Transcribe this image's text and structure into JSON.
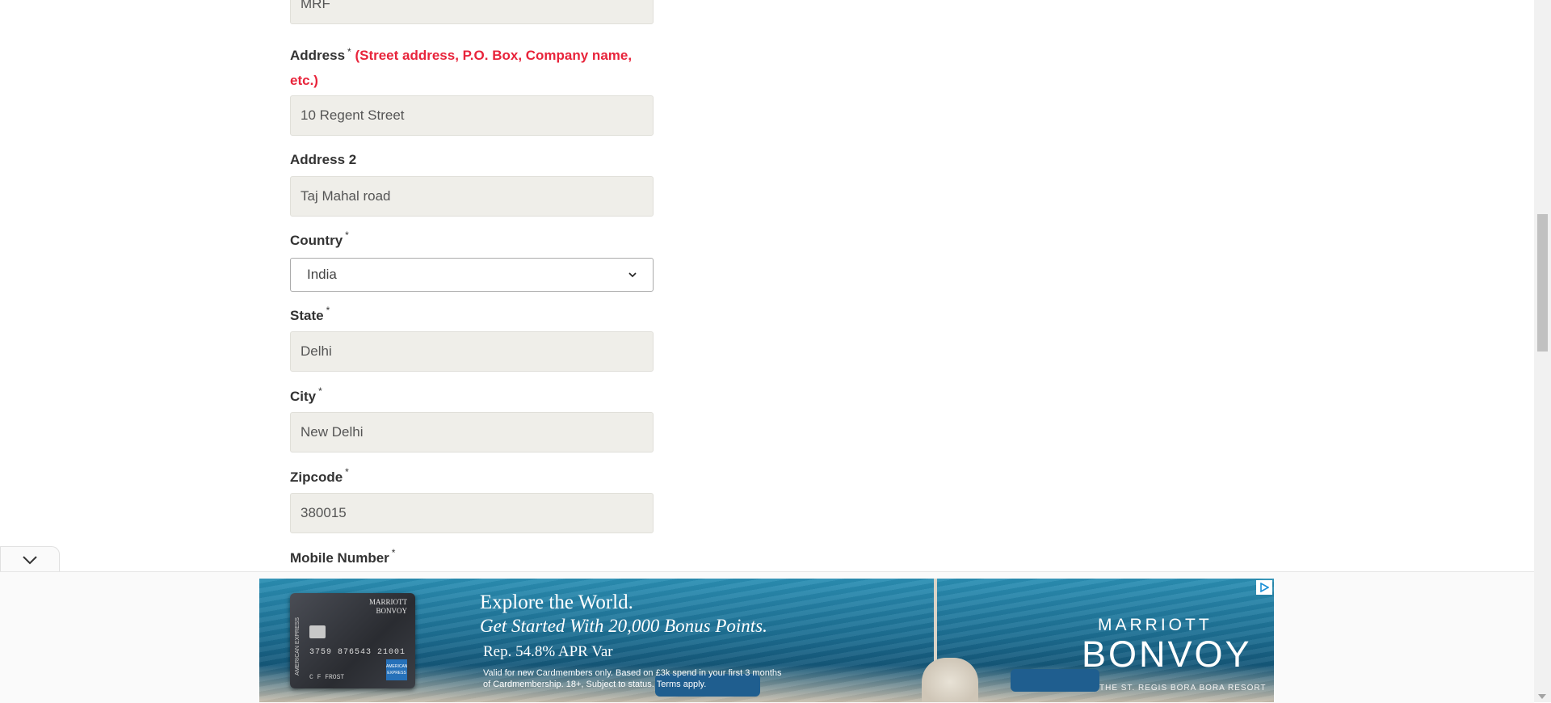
{
  "form": {
    "company_value": "MRF",
    "address": {
      "label": "Address",
      "required_mark": "*",
      "hint": "(Street address, P.O. Box, Company name, etc.)",
      "value": "10 Regent Street"
    },
    "address2": {
      "label": "Address 2",
      "value": "Taj Mahal road"
    },
    "country": {
      "label": "Country",
      "required_mark": "*",
      "selected": "India"
    },
    "state": {
      "label": "State",
      "required_mark": "*",
      "value": "Delhi"
    },
    "city": {
      "label": "City",
      "required_mark": "*",
      "value": "New Delhi"
    },
    "zipcode": {
      "label": "Zipcode",
      "required_mark": "*",
      "value": "380015"
    },
    "mobile": {
      "label": "Mobile Number",
      "required_mark": "*"
    }
  },
  "ad": {
    "line1": "Explore the World.",
    "line2": "Get Started With 20,000 Bonus Points.",
    "line3": "Rep. 54.8% APR Var",
    "small_line1": "Valid for new Cardmembers only. Based on £3k spend in your first 3 months",
    "small_line2": "of Cardmembership. 18+, Subject to status. Terms apply.",
    "brand_top": "MARRIOTT",
    "brand_main": "BONVOY",
    "brand_sub": "THE ST. REGIS BORA BORA RESORT",
    "card_brand_top": "MARRIOTT",
    "card_brand_main": "BONVOY",
    "card_number": "3759 876543 21001",
    "card_name": "C F FROST",
    "card_side_text": "AMERICAN EXPRESS",
    "card_amex_text": "AMERICAN EXPRESS"
  },
  "colors": {
    "hint_red": "#e8243b",
    "input_bg": "#efeee9",
    "ad_blue": "#1d6f93"
  },
  "icons": {
    "select_arrow": "chevron-down-icon",
    "collapse": "chevron-down-icon",
    "adchoices": "adchoices-icon"
  }
}
